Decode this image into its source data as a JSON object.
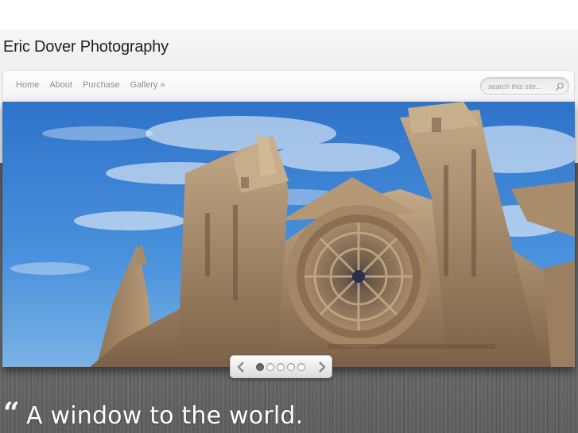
{
  "site": {
    "title": "Eric Dover Photography"
  },
  "nav": {
    "items": [
      {
        "label": "Home"
      },
      {
        "label": "About"
      },
      {
        "label": "Purchase"
      },
      {
        "label": "Gallery »"
      }
    ]
  },
  "search": {
    "placeholder": "search this site..."
  },
  "slider": {
    "slide_count": 5,
    "active_index": 0
  },
  "tagline": {
    "quote_mark": "“",
    "text": "A window to the world."
  },
  "colors": {
    "sky": "#3f86d6",
    "stone": "#a98c6a",
    "background": "#616161"
  },
  "icons": {
    "search": "search-icon",
    "prev": "chevron-left-icon",
    "next": "chevron-right-icon"
  }
}
